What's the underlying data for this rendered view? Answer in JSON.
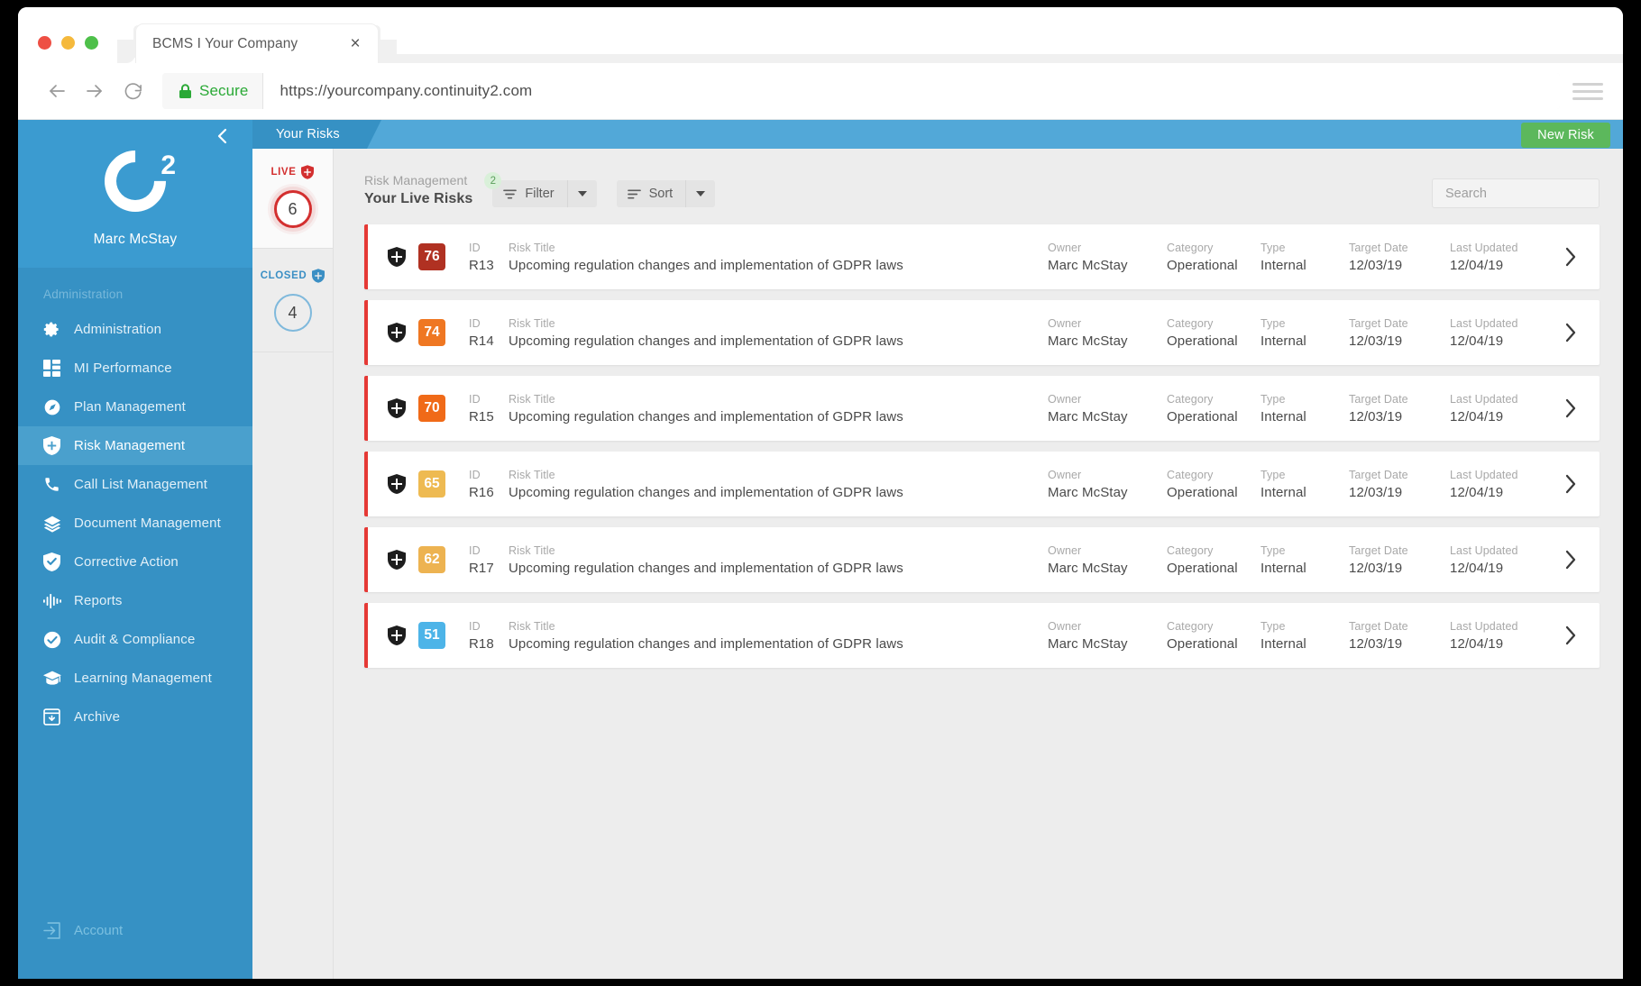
{
  "browser": {
    "tab_title": "BCMS I Your Company",
    "close_label": "×",
    "secure_label": "Secure",
    "url": "https://yourcompany.continuity2.com"
  },
  "sidebar": {
    "user_name": "Marc McStay",
    "logo_letter": "C",
    "logo_sub": "2",
    "section_label": "Administration",
    "items": [
      {
        "label": "Administration",
        "icon": "gear-icon"
      },
      {
        "label": "MI Performance",
        "icon": "dashboard-icon"
      },
      {
        "label": "Plan Management",
        "icon": "compass-icon"
      },
      {
        "label": "Risk Management",
        "icon": "shield-icon"
      },
      {
        "label": "Call List Management",
        "icon": "phone-icon"
      },
      {
        "label": "Document Management",
        "icon": "layers-icon"
      },
      {
        "label": "Corrective Action",
        "icon": "shield-check-icon"
      },
      {
        "label": "Reports",
        "icon": "waveform-icon"
      },
      {
        "label": "Audit & Compliance",
        "icon": "check-circle-icon"
      },
      {
        "label": "Learning Management",
        "icon": "graduation-cap-icon"
      },
      {
        "label": "Archive",
        "icon": "archive-icon"
      }
    ],
    "active_index": 3,
    "account_label": "Account"
  },
  "topbar": {
    "tab_label": "Your Risks",
    "new_risk_label": "New Risk"
  },
  "status_rail": {
    "live": {
      "label": "LIVE",
      "count": "6"
    },
    "closed": {
      "label": "CLOSED",
      "count": "4"
    }
  },
  "main": {
    "breadcrumb": "Risk Management",
    "page_title": "Your Live Risks",
    "filter_label": "Filter",
    "filter_badge": "2",
    "sort_label": "Sort",
    "search_placeholder": "Search"
  },
  "columns": {
    "id": "ID",
    "title": "Risk Title",
    "owner": "Owner",
    "category": "Category",
    "type": "Type",
    "target_date": "Target Date",
    "last_updated": "Last Updated"
  },
  "colors": {
    "accent_blue": "#3691c4",
    "topbar_blue": "#52a8d8",
    "new_risk_green": "#5cb85c",
    "row_accent_red": "#e53935",
    "live_red": "#d32f2f",
    "closed_blue": "#3b8fc4"
  },
  "rows": [
    {
      "score": "76",
      "score_color": "#b03122",
      "id": "R13",
      "title": "Upcoming regulation changes and implementation of GDPR laws",
      "owner": "Marc McStay",
      "category": "Operational",
      "type": "Internal",
      "target_date": "12/03/19",
      "last_updated": "12/04/19"
    },
    {
      "score": "74",
      "score_color": "#ef7722",
      "id": "R14",
      "title": "Upcoming regulation changes and implementation of GDPR laws",
      "owner": "Marc McStay",
      "category": "Operational",
      "type": "Internal",
      "target_date": "12/03/19",
      "last_updated": "12/04/19"
    },
    {
      "score": "70",
      "score_color": "#f06a18",
      "id": "R15",
      "title": "Upcoming regulation changes and implementation of GDPR laws",
      "owner": "Marc McStay",
      "category": "Operational",
      "type": "Internal",
      "target_date": "12/03/19",
      "last_updated": "12/04/19"
    },
    {
      "score": "65",
      "score_color": "#eeba52",
      "id": "R16",
      "title": "Upcoming regulation changes and implementation of GDPR laws",
      "owner": "Marc McStay",
      "category": "Operational",
      "type": "Internal",
      "target_date": "12/03/19",
      "last_updated": "12/04/19"
    },
    {
      "score": "62",
      "score_color": "#edb351",
      "id": "R17",
      "title": "Upcoming regulation changes and implementation of GDPR laws",
      "owner": "Marc McStay",
      "category": "Operational",
      "type": "Internal",
      "target_date": "12/03/19",
      "last_updated": "12/04/19"
    },
    {
      "score": "51",
      "score_color": "#4db4e8",
      "id": "R18",
      "title": "Upcoming regulation changes and implementation of GDPR laws",
      "owner": "Marc McStay",
      "category": "Operational",
      "type": "Internal",
      "target_date": "12/03/19",
      "last_updated": "12/04/19"
    }
  ]
}
